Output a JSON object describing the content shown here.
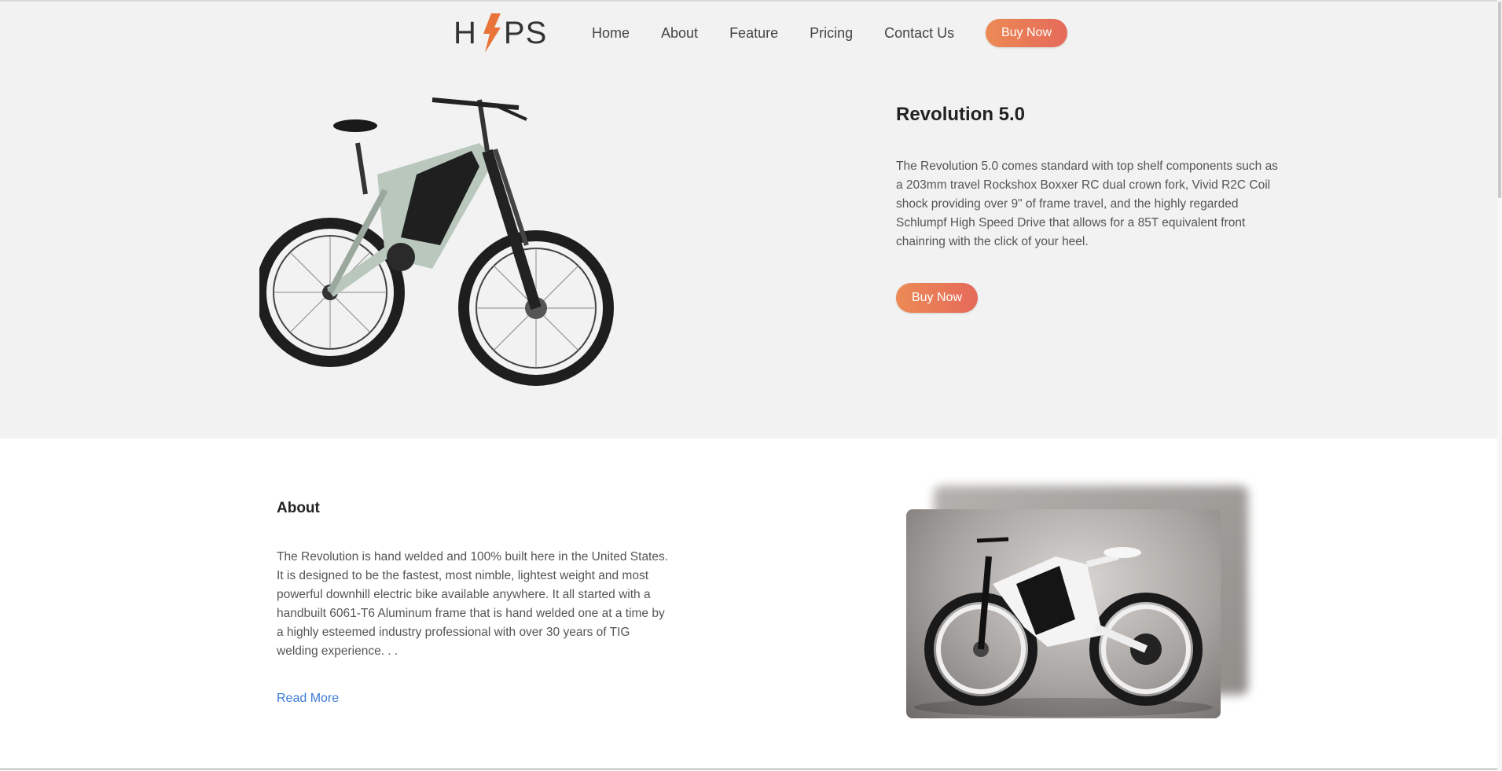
{
  "brand": {
    "left": "H",
    "right": "PS",
    "accent_color": "#e8743a"
  },
  "nav": {
    "items": [
      {
        "label": "Home"
      },
      {
        "label": "About"
      },
      {
        "label": "Feature"
      },
      {
        "label": "Pricing"
      },
      {
        "label": "Contact Us"
      }
    ],
    "buy_label": "Buy Now"
  },
  "hero": {
    "title": "Revolution 5.0",
    "description": "The Revolution 5.0 comes standard with top shelf components such as a 203mm travel Rockshox Boxxer RC dual crown fork, Vivid R2C Coil shock providing over 9\" of frame travel, and the highly regarded Schlumpf High Speed Drive that allows for a 85T equivalent front chainring with the click of your heel.",
    "buy_label": "Buy Now",
    "image": "electric-mountain-bike-side-view"
  },
  "about": {
    "title": "About",
    "description": "The Revolution is hand welded and 100% built here in the United States. It is designed to be the fastest, most nimble, lightest weight and most powerful downhill electric bike available anywhere. It all started with a handbuilt 6061-T6 Aluminum frame that is hand welded one at a time by a highly esteemed industry professional with over 30 years of TIG welding experience. . .",
    "read_more": "Read More",
    "image": "white-electric-bike-studio-photo"
  },
  "colors": {
    "hero_bg": "#f2f2f2",
    "button_gradient_start": "#ec8a55",
    "button_gradient_end": "#e56a5a",
    "link": "#3a7bd5"
  }
}
